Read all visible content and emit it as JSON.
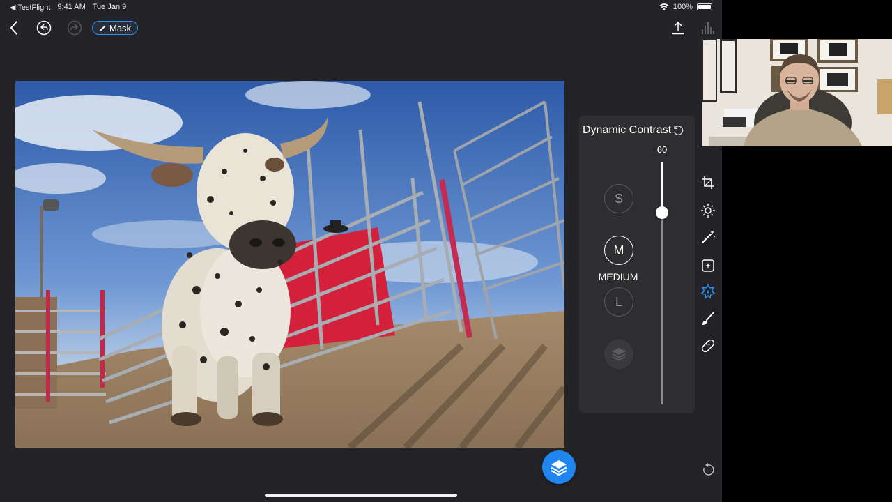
{
  "status_bar": {
    "back_app": "◀ TestFlight",
    "time": "9:41 AM",
    "date": "Tue Jan 9",
    "battery": "100%"
  },
  "toolbar": {
    "mask_label": "Mask"
  },
  "panel": {
    "title": "Dynamic Contrast",
    "value": "60",
    "value_fraction": 0.21,
    "sizes": {
      "small": "S",
      "medium": "M",
      "large": "L",
      "selected_label": "MEDIUM"
    }
  },
  "tools": [
    "crop-icon",
    "light-icon",
    "magic-wand-icon",
    "enhance-icon",
    "details-icon",
    "brush-icon",
    "healing-icon"
  ],
  "colors": {
    "accent": "#1f86f0",
    "active_tool": "#2d8cf0",
    "background": "#242428",
    "panel": "#2e2e31"
  }
}
